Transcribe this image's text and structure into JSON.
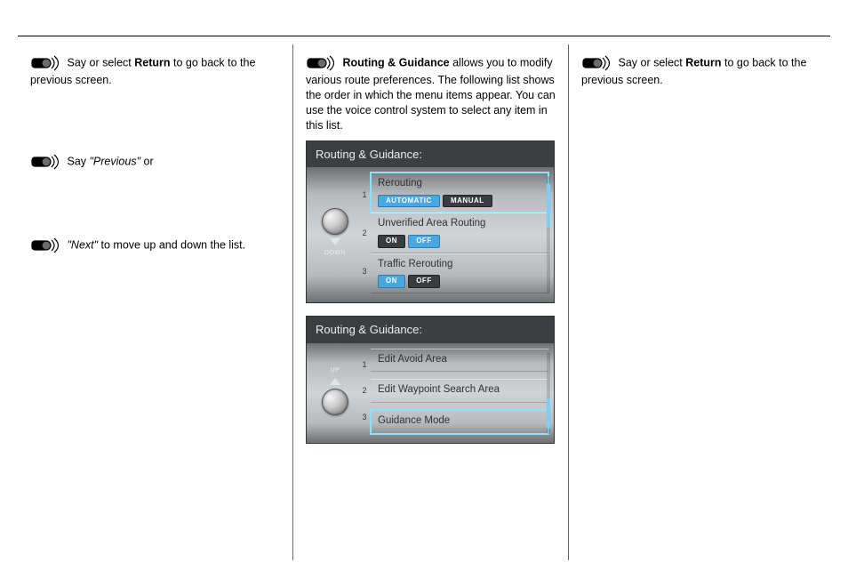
{
  "say_icon_title": "voice-command-icon",
  "col1": {
    "line1_prefix": "Say or select ",
    "line1_bold": "Return",
    "line1_suffix": " to go back to the previous screen.",
    "line2_prefix": "Say ",
    "line2_italic": "\"Previous\"",
    "line2_suffix": " or",
    "line3_prefix": "",
    "line3_italic": "\"Next\"",
    "line3_suffix": " to move up and down the list."
  },
  "col2": {
    "intro_bold": "Routing & Guidance",
    "intro_tail": " allows you to modify various route preferences.",
    "rest": " The following list shows the order in which the menu items appear. You can use the voice control system to select any item in this list.",
    "panel1": {
      "title": "Routing & Guidance:",
      "items": [
        {
          "label": "Rerouting",
          "highlight": true,
          "pills": [
            {
              "text": "AUTOMATIC",
              "style": "blue"
            },
            {
              "text": "MANUAL",
              "style": "dark"
            }
          ]
        },
        {
          "label": "Unverified Area Routing",
          "highlight": false,
          "pills": [
            {
              "text": "ON",
              "style": "dark"
            },
            {
              "text": "OFF",
              "style": "blue"
            }
          ]
        },
        {
          "label": "Traffic Rerouting",
          "highlight": false,
          "pills": [
            {
              "text": "ON",
              "style": "blue"
            },
            {
              "text": "OFF",
              "style": "dark"
            }
          ]
        }
      ],
      "nums": [
        "1",
        "2",
        "3"
      ],
      "arrow": "down",
      "arrow_label": "DOWN",
      "thumb_top": "6%",
      "thumb_height": "38%"
    },
    "panel2": {
      "title": "Routing & Guidance:",
      "items": [
        {
          "label": "Edit Avoid Area",
          "highlight": false
        },
        {
          "label": "Edit Waypoint Search Area",
          "highlight": false
        },
        {
          "label": "Guidance Mode",
          "highlight": true
        }
      ],
      "nums": [
        "1",
        "2",
        "3"
      ],
      "arrow": "up",
      "arrow_label": "UP",
      "thumb_top": "56%",
      "thumb_height": "38%"
    }
  },
  "col3": {
    "line1_prefix": "Say or select ",
    "line1_bold": "Return",
    "line1_suffix": " to go back to the previous screen."
  }
}
